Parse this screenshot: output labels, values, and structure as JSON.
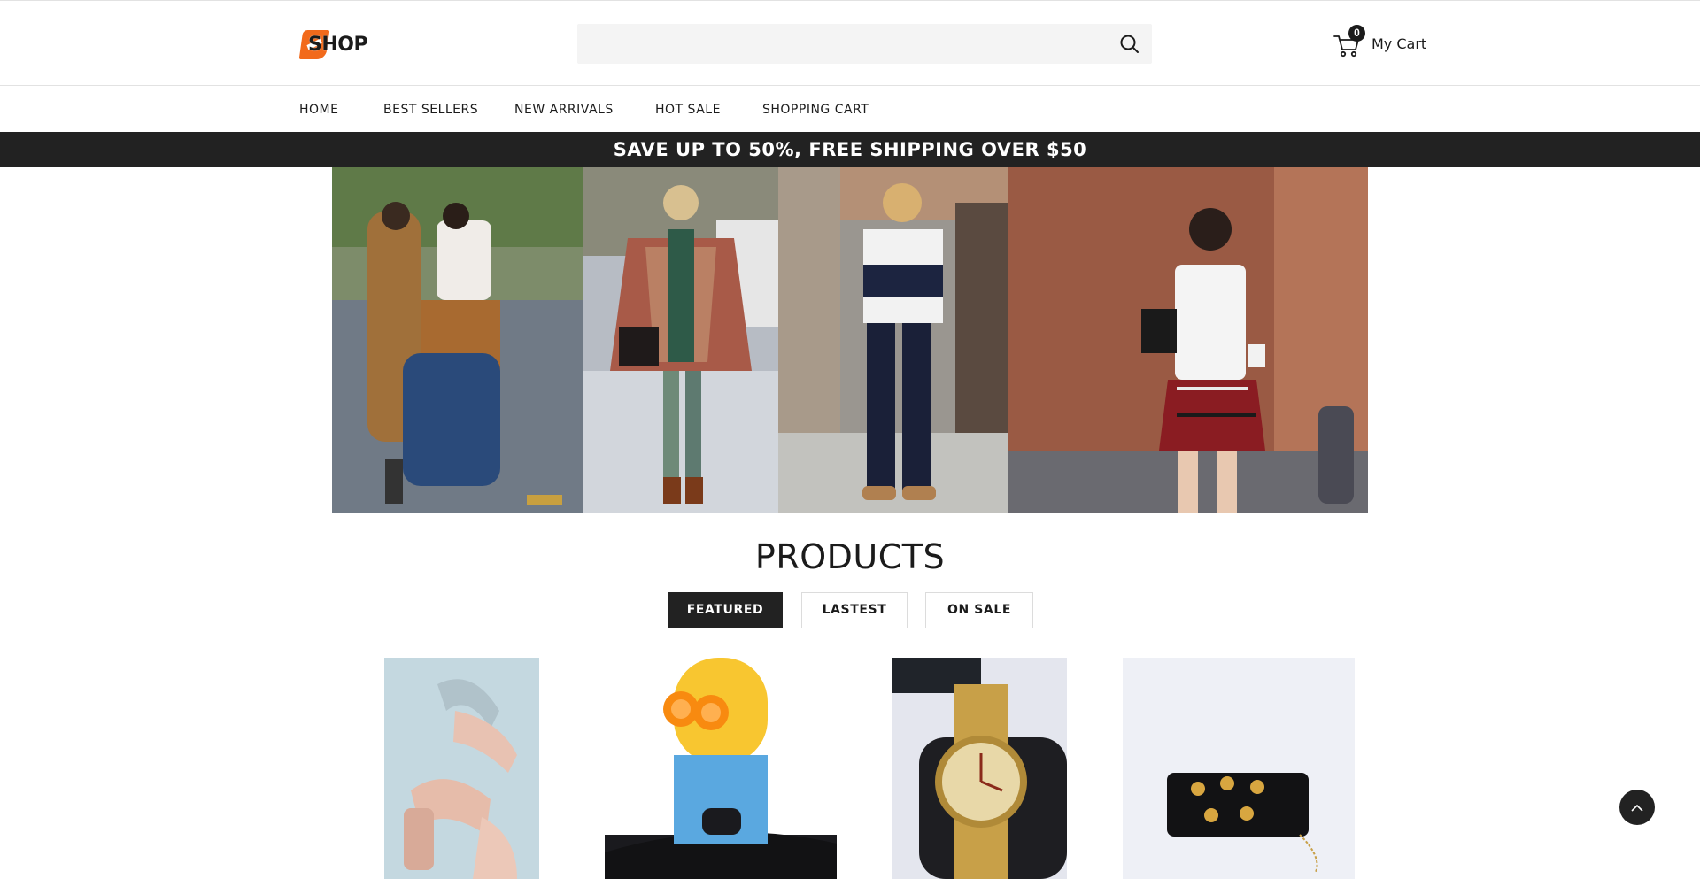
{
  "header": {
    "logo_text": "SHOP",
    "search": {
      "placeholder": "",
      "value": "",
      "icon": "search-icon"
    },
    "cart": {
      "count": "0",
      "label": "My Cart",
      "icon": "cart-icon"
    }
  },
  "nav": {
    "items": [
      {
        "label": "HOME"
      },
      {
        "label": "BEST SELLERS"
      },
      {
        "label": "NEW ARRIVALS"
      },
      {
        "label": "HOT SALE"
      },
      {
        "label": "SHOPPING CART"
      }
    ]
  },
  "promo": {
    "text": "SAVE UP TO 50%, FREE SHIPPING OVER $50"
  },
  "hero": {
    "panels": [
      {
        "name": "two-women-crossing-street"
      },
      {
        "name": "woman-plaid-poncho"
      },
      {
        "name": "woman-striped-tee"
      },
      {
        "name": "woman-plaid-skirt-coffee"
      }
    ]
  },
  "products": {
    "title": "PRODUCTS",
    "tabs": [
      {
        "label": "FEATURED",
        "active": true
      },
      {
        "label": "LASTEST",
        "active": false
      },
      {
        "label": "ON SALE",
        "active": false
      }
    ],
    "items": [
      {
        "name": "pink-heeled-sandals"
      },
      {
        "name": "minion-speaker"
      },
      {
        "name": "gold-watch"
      },
      {
        "name": "black-clutch-bag"
      }
    ]
  },
  "colors": {
    "accent": "#f26a1b",
    "dark": "#222222",
    "search_bg": "#f4f4f4"
  },
  "back_to_top": {
    "icon": "chevron-up-icon"
  }
}
